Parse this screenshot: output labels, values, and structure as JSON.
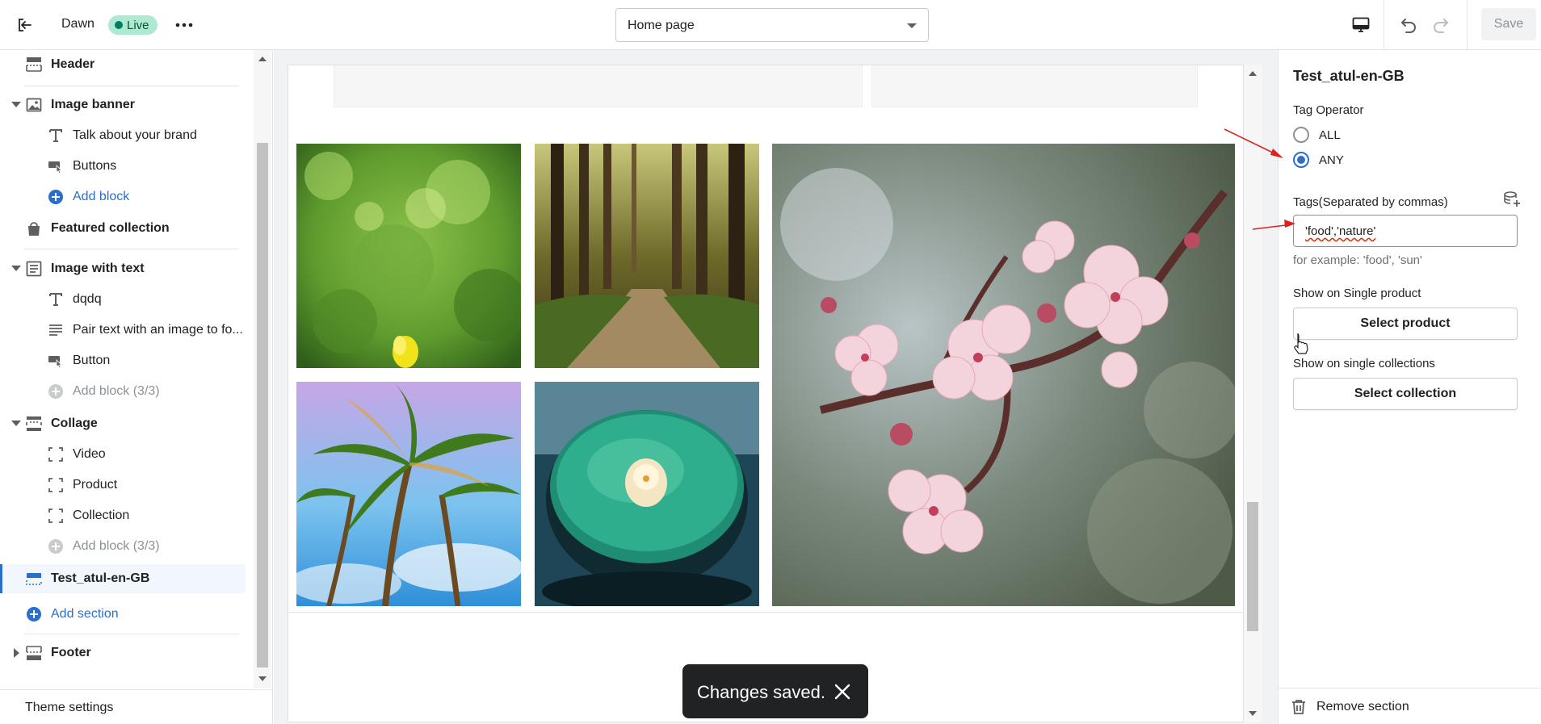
{
  "topbar": {
    "theme_name": "Dawn",
    "live_label": "Live",
    "more_label": "•••",
    "page_select_value": "Home page",
    "save_label": "Save"
  },
  "sidebar": {
    "header_label": "Header",
    "image_banner": {
      "label": "Image banner",
      "blocks": [
        "Talk about your brand",
        "Buttons"
      ],
      "add_block": "Add block"
    },
    "featured_collection": "Featured collection",
    "image_with_text": {
      "label": "Image with text",
      "blocks": [
        "dqdq",
        "Pair text with an image to fo...",
        "Button"
      ],
      "add_block": "Add block (3/3)"
    },
    "collage": {
      "label": "Collage",
      "blocks": [
        "Video",
        "Product",
        "Collection"
      ],
      "add_block": "Add block (3/3)"
    },
    "selected_section": "Test_atul-en-GB",
    "add_section": "Add section",
    "footer": "Footer",
    "theme_settings": "Theme settings"
  },
  "toast": {
    "message": "Changes saved."
  },
  "settings_panel": {
    "title": "Test_atul-en-GB",
    "tag_operator_label": "Tag Operator",
    "options": [
      "ALL",
      "ANY"
    ],
    "selected_option": "ANY",
    "tags_label": "Tags(Separated by commas)",
    "tags_value": "'food','nature'",
    "tags_help": "for example: 'food', 'sun'",
    "single_product_label": "Show on Single product",
    "select_product": "Select product",
    "single_collections_label": "Show on single collections",
    "select_collection": "Select collection",
    "remove_section": "Remove section"
  },
  "colors": {
    "accent": "#2c6ecb",
    "live_bg": "#aee9d1",
    "toast_bg": "#202223",
    "annotation_arrow": "#e02020"
  }
}
